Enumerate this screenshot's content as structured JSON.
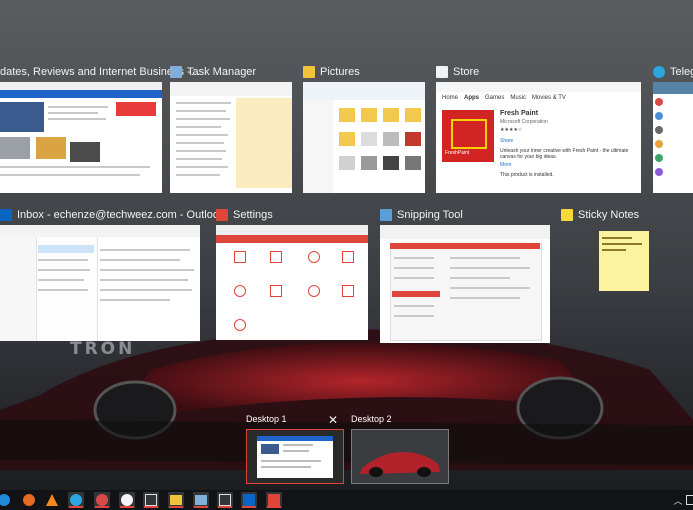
{
  "windows": [
    {
      "title": "dates, Reviews and Internet Business -...",
      "icon": "browser-icon"
    },
    {
      "title": "Task Manager",
      "icon": "task-manager-icon"
    },
    {
      "title": "Pictures",
      "icon": "folder-icon"
    },
    {
      "title": "Store",
      "icon": "store-icon"
    },
    {
      "title": "Telegr",
      "icon": "telegram-icon"
    },
    {
      "title": "Inbox - echenze@techweez.com - Outlook",
      "icon": "outlook-icon"
    },
    {
      "title": "Settings",
      "icon": "settings-icon"
    },
    {
      "title": "Snipping Tool",
      "icon": "scissors-icon"
    },
    {
      "title": "Sticky Notes",
      "icon": "sticky-notes-icon"
    }
  ],
  "store": {
    "nav_home": "Home",
    "nav_apps": "Apps",
    "nav_games": "Games",
    "nav_music": "Music",
    "nav_movies": "Movies & TV",
    "app_name": "Fresh Paint",
    "publisher": "Microsoft Corporation",
    "share": "Share",
    "logo_text": "FreshPaint",
    "description": "Unleash your inner creative with Fresh Paint - the ultimate canvas for your big ideas.",
    "more": "More",
    "installed": "This product is installed."
  },
  "desktops": [
    {
      "label": "Desktop 1"
    },
    {
      "label": "Desktop 2"
    }
  ],
  "close_glyph": "✕",
  "colors": {
    "accent": "#e0453b",
    "store_red": "#d32424",
    "sticky": "#fbf39d"
  }
}
